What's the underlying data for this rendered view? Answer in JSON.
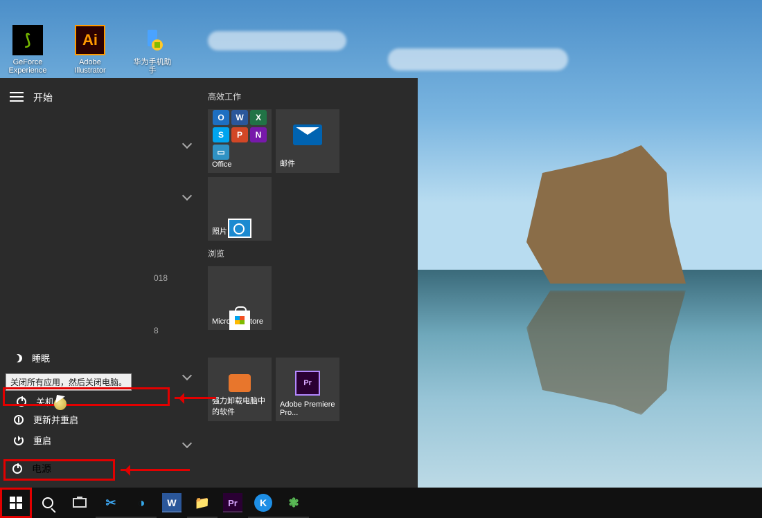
{
  "desktop": {
    "icons": [
      {
        "label": "GeForce Experience",
        "cls": "nvidia"
      },
      {
        "label": "Adobe Illustrator",
        "cls": "ai"
      },
      {
        "label": "华为手机助手",
        "cls": "huawei"
      }
    ]
  },
  "start": {
    "title": "开始",
    "app_list": {
      "date_frag_1": "018",
      "date_frag_2": "8"
    },
    "groups": [
      {
        "title": "高效工作",
        "tiles": [
          {
            "label": "Office",
            "icon": "office"
          },
          {
            "label": "邮件",
            "icon": "mail"
          },
          {
            "label": "照片",
            "icon": "photo"
          }
        ]
      },
      {
        "title": "浏览",
        "tiles": [
          {
            "label": "Microsoft Store",
            "icon": "store"
          },
          {
            "label": "强力卸载电脑中的软件",
            "icon": "orange"
          },
          {
            "label": "Adobe Premiere Pro...",
            "icon": "pr"
          }
        ]
      }
    ],
    "power": {
      "sleep": "睡眠",
      "shutdown": "关机",
      "update_restart": "更新并重启",
      "restart": "重启",
      "button_label": "电源",
      "tooltip": "关闭所有应用，然后关闭电脑。"
    }
  },
  "taskbar": {
    "apps": [
      "snip",
      "edge",
      "word",
      "explorer",
      "premiere",
      "kugou",
      "wechat"
    ]
  }
}
